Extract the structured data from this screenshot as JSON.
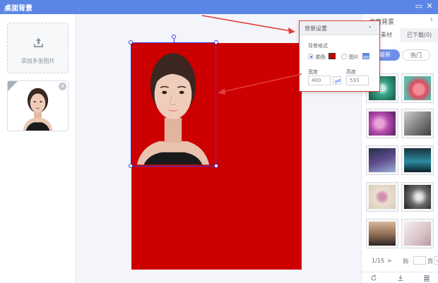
{
  "window": {
    "title": "桌面背景",
    "minimize_glyph": "▭",
    "close_glyph": "✕"
  },
  "left_panel": {
    "add_label": "添加多张图片",
    "thumb_remove_glyph": "✕"
  },
  "right_panel": {
    "header": "桌面背景",
    "header_arrow": "⇕",
    "tabs": [
      {
        "label": "背景素材"
      },
      {
        "label": "已下载(0)"
      }
    ],
    "filters": [
      {
        "label": "最新"
      },
      {
        "label": "热门"
      }
    ],
    "pager": {
      "current": "1/15",
      "next": ">",
      "goto": "到",
      "page": "页",
      "go_glyph": "»"
    }
  },
  "popup": {
    "title": "背景设置",
    "title_arrow": "▾",
    "format_label": "背景格式",
    "option_color": "颜色",
    "option_image": "图片",
    "width_label": "宽度",
    "height_label": "高度",
    "width_value": "400",
    "height_value": "533",
    "selected_option": "颜色"
  },
  "colors": {
    "titlebar": "#5b86e5",
    "background_color": "#cc0000",
    "selection_border": "#3b3bd6",
    "highlight": "#e23b3b"
  }
}
